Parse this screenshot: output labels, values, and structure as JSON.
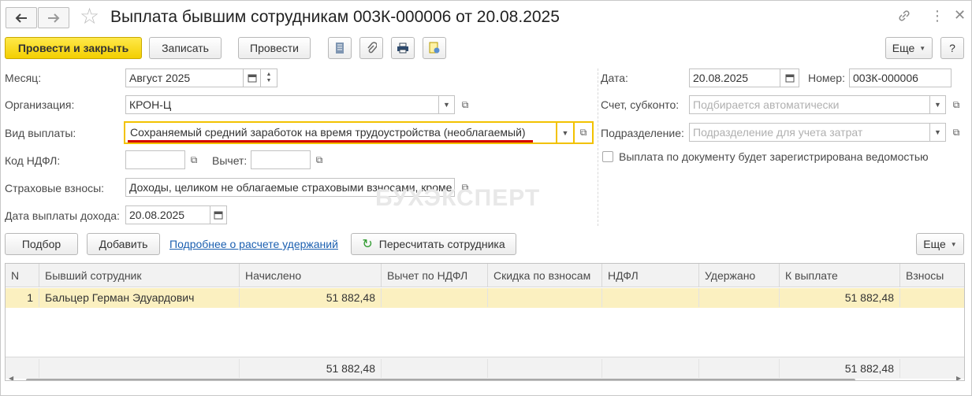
{
  "window": {
    "title": "Выплата бывшим сотрудникам 003К-000006 от 20.08.2025"
  },
  "icons": [
    "arrow-left-icon",
    "arrow-right-icon",
    "star-icon",
    "link-icon",
    "more-vert-icon",
    "close-icon",
    "list-icon",
    "paperclip-icon",
    "print-icon",
    "report-icon",
    "refresh-icon",
    "calendar-icon",
    "dropdown-icon",
    "open-icon"
  ],
  "toolbar": {
    "post_close": "Провести и закрыть",
    "save": "Записать",
    "post": "Провести",
    "more": "Еще",
    "help": "?"
  },
  "form": {
    "month_label": "Месяц:",
    "month_value": "Август 2025",
    "org_label": "Организация:",
    "org_value": "КРОН-Ц",
    "pay_type_label": "Вид выплаты:",
    "pay_type_value": "Сохраняемый средний заработок на время трудоустройства (необлагаемый)",
    "ndfl_code_label": "Код НДФЛ:",
    "ndfl_code_value": "",
    "deduction_label": "Вычет:",
    "deduction_value": "",
    "insurance_label": "Страховые взносы:",
    "insurance_value": "Доходы, целиком не облагаемые страховыми взносами, кроме",
    "income_date_label": "Дата выплаты дохода:",
    "income_date_value": "20.08.2025",
    "date_label": "Дата:",
    "date_value": "20.08.2025",
    "number_label": "Номер:",
    "number_value": "003К-000006",
    "account_label": "Счет, субконто:",
    "account_placeholder": "Подбирается автоматически",
    "dept_label": "Подразделение:",
    "dept_placeholder": "Подразделение для учета затрат",
    "statement_checkbox_label": "Выплата по документу будет зарегистрирована ведомостью",
    "statement_checked": false
  },
  "actions": {
    "pick": "Подбор",
    "add": "Добавить",
    "details_link": "Подробнее о расчете удержаний",
    "recalc": "Пересчитать сотрудника",
    "more": "Еще"
  },
  "table": {
    "headers": [
      "N",
      "Бывший сотрудник",
      "Начислено",
      "Вычет по НДФЛ",
      "Скидка по взносам",
      "НДФЛ",
      "Удержано",
      "К выплате",
      "Взносы"
    ],
    "rows": [
      [
        "1",
        "Бальцер Герман Эдуардович",
        "51 882,48",
        "",
        "",
        "",
        "",
        "51 882,48",
        ""
      ]
    ],
    "totals": [
      "",
      "",
      "51 882,48",
      "",
      "",
      "",
      "",
      "51 882,48",
      ""
    ]
  },
  "watermark": "БУХЭКСПЕРТ"
}
